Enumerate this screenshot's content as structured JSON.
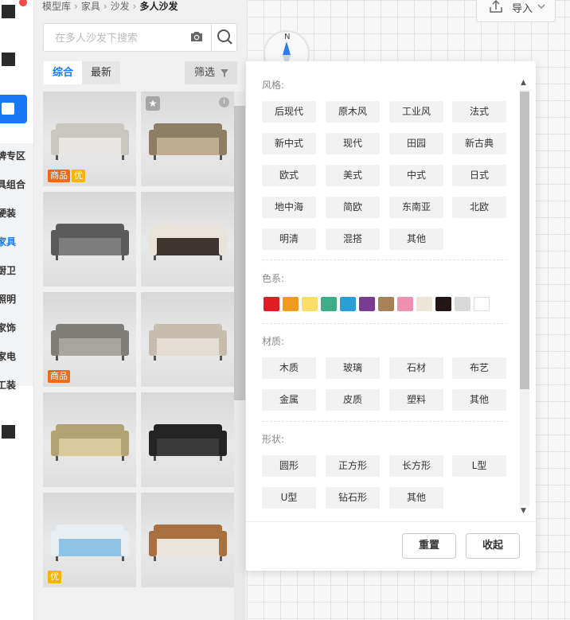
{
  "rail": {
    "items": [
      {
        "label": "牌专区"
      },
      {
        "label": "具组合"
      },
      {
        "label": "硬装"
      },
      {
        "label": "家具"
      },
      {
        "label": "厨卫"
      },
      {
        "label": "照明"
      },
      {
        "label": "家饰"
      },
      {
        "label": "家电"
      },
      {
        "label": "工装"
      }
    ],
    "active_index": 3
  },
  "breadcrumb": {
    "items": [
      "模型库",
      "家具",
      "沙发"
    ],
    "current": "多人沙发",
    "separator": "›"
  },
  "search": {
    "placeholder": "在多人沙发下搜索",
    "value": ""
  },
  "tabs": [
    {
      "label": "综合",
      "active": true
    },
    {
      "label": "最新",
      "active": false
    }
  ],
  "filter_button": {
    "label": "筛选"
  },
  "cards": [
    {
      "badges": [
        "商品",
        "优"
      ]
    },
    {
      "badges": []
    },
    {
      "badges": []
    },
    {
      "badges": []
    },
    {
      "badges": [
        "商品"
      ]
    },
    {
      "badges": []
    },
    {
      "badges": []
    },
    {
      "badges": []
    },
    {
      "badges": [
        "优"
      ]
    },
    {
      "badges": []
    }
  ],
  "canvas": {
    "import_label": "导入",
    "compass_label": "N"
  },
  "filter_panel": {
    "style": {
      "title": "风格:",
      "options": [
        "后现代",
        "原木风",
        "工业风",
        "法式",
        "新中式",
        "现代",
        "田园",
        "新古典",
        "欧式",
        "美式",
        "中式",
        "日式",
        "地中海",
        "简欧",
        "东南亚",
        "北欧",
        "明清",
        "混搭",
        "其他"
      ]
    },
    "color": {
      "title": "色系:",
      "swatches": [
        "#e21c24",
        "#f29a20",
        "#fadd6b",
        "#3cad85",
        "#2b9ed6",
        "#7a3b92",
        "#a68155",
        "#ef8fb1",
        "#ede6d6",
        "#231516",
        "#d9d9d9",
        "#ffffff"
      ]
    },
    "material": {
      "title": "材质:",
      "options": [
        "木质",
        "玻璃",
        "石材",
        "布艺",
        "金属",
        "皮质",
        "塑料",
        "其他"
      ]
    },
    "shape": {
      "title": "形状:",
      "options": [
        "圆形",
        "正方形",
        "长方形",
        "L型",
        "U型",
        "钻石形",
        "其他"
      ]
    },
    "reset_label": "重置",
    "collapse_label": "收起"
  }
}
